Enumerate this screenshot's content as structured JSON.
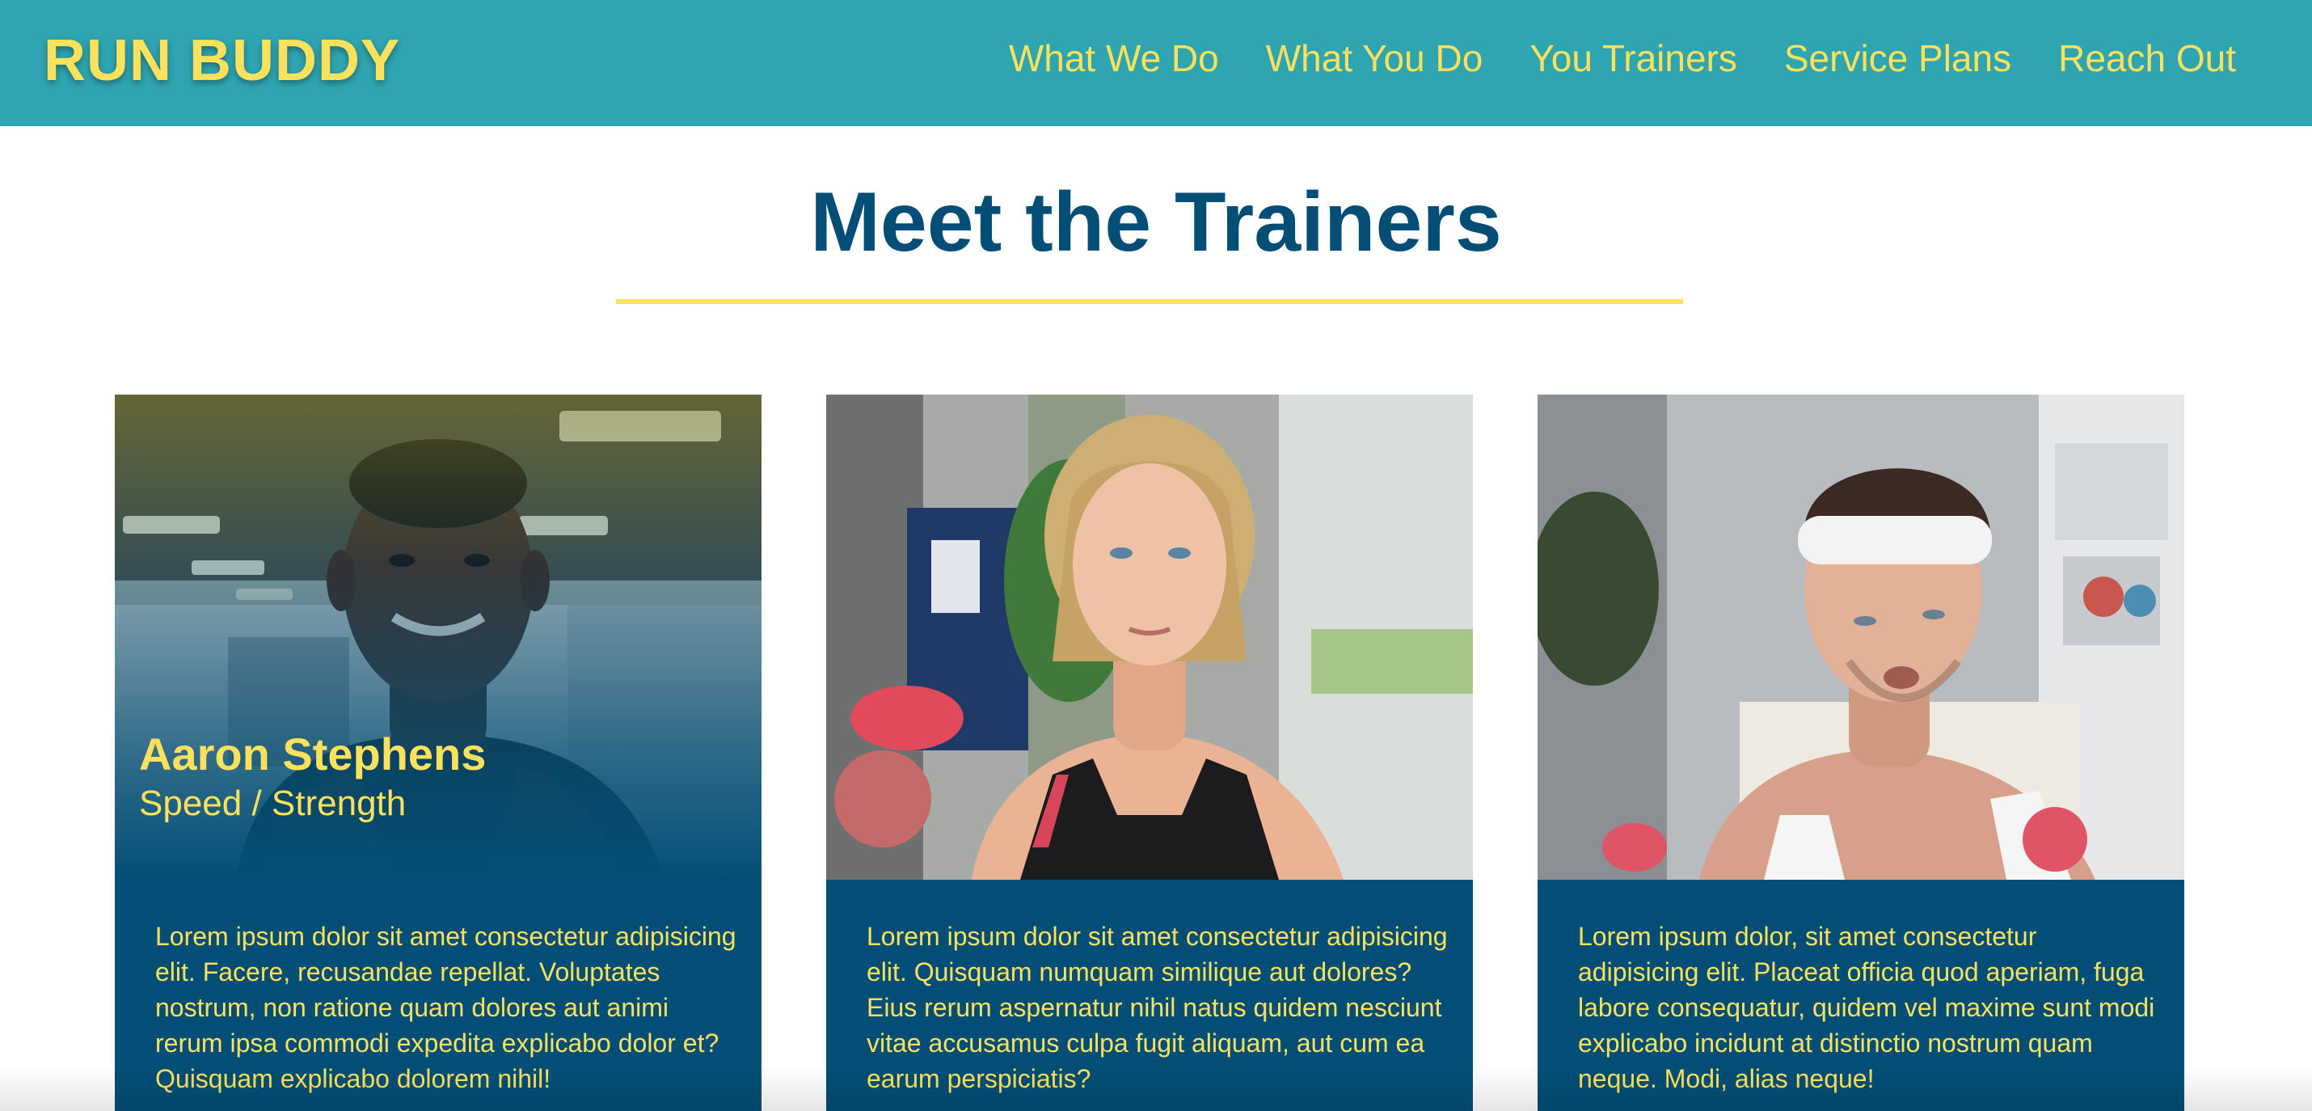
{
  "header": {
    "logo": "RUN BUDDY",
    "nav": [
      {
        "label": "What We Do"
      },
      {
        "label": "What You Do"
      },
      {
        "label": "You Trainers"
      },
      {
        "label": "Service Plans"
      },
      {
        "label": "Reach Out"
      }
    ]
  },
  "section": {
    "title": "Meet the Trainers"
  },
  "trainers": [
    {
      "name": "Aaron Stephens",
      "role": "Speed / Strength",
      "bio": "Lorem ipsum dolor sit amet consectetur adipisicing elit. Facere, recusandae repellat. Voluptates nostrum, non ratione quam dolores aut animi rerum ipsa commodi expedita explicabo dolor et? Quisquam explicabo dolorem nihil!"
    },
    {
      "name": "",
      "role": "",
      "bio": "Lorem ipsum dolor sit amet consectetur adipisicing elit. Quisquam numquam similique aut dolores? Eius rerum aspernatur nihil natus quidem nesciunt vitae accusamus culpa fugit aliquam, aut cum ea earum perspiciatis?"
    },
    {
      "name": "",
      "role": "",
      "bio": "Lorem ipsum dolor, sit amet consectetur adipisicing elit. Placeat officia quod aperiam, fuga labore consequatur, quidem vel maxime sunt modi explicabo incidunt at distinctio nostrum quam neque. Modi, alias neque!"
    }
  ],
  "colors": {
    "header_bg": "#2ea5b1",
    "accent_yellow": "#fce25c",
    "navy": "#024e76"
  }
}
